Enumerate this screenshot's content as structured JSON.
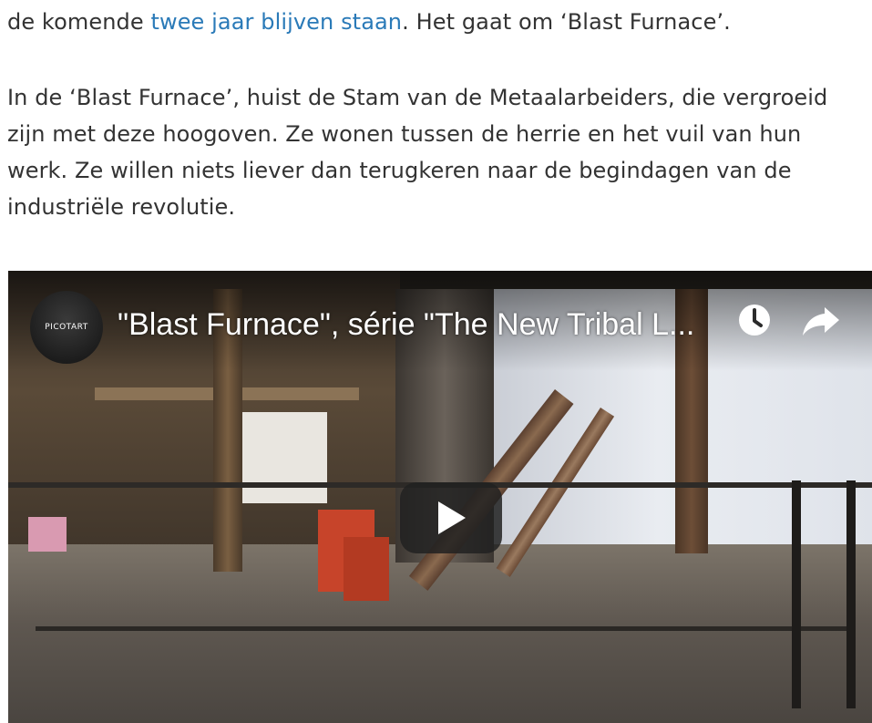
{
  "article": {
    "line1_prefix": "de komende ",
    "line1_link": "twee jaar blijven staan",
    "line1_suffix": ".  Het gaat om ‘Blast Furnace’.",
    "paragraph2": "In de ‘Blast Furnace’, huist de Stam van de Metaalarbeiders, die vergroeid zijn met deze hoogoven. Ze wonen tussen de herrie en het vuil van hun werk. Ze willen niets liever dan terugkeren naar de begindagen van de industriële revolutie."
  },
  "video": {
    "title": "\"Blast Furnace\", série \"The New Tribal L...",
    "channel_logo_text": "PICOTART",
    "icons": {
      "watch_later": "clock-icon",
      "share": "share-arrow-icon",
      "play": "play-icon"
    },
    "colors": {
      "link": "#2a7ab8",
      "play_button_bg": "#212121"
    }
  }
}
